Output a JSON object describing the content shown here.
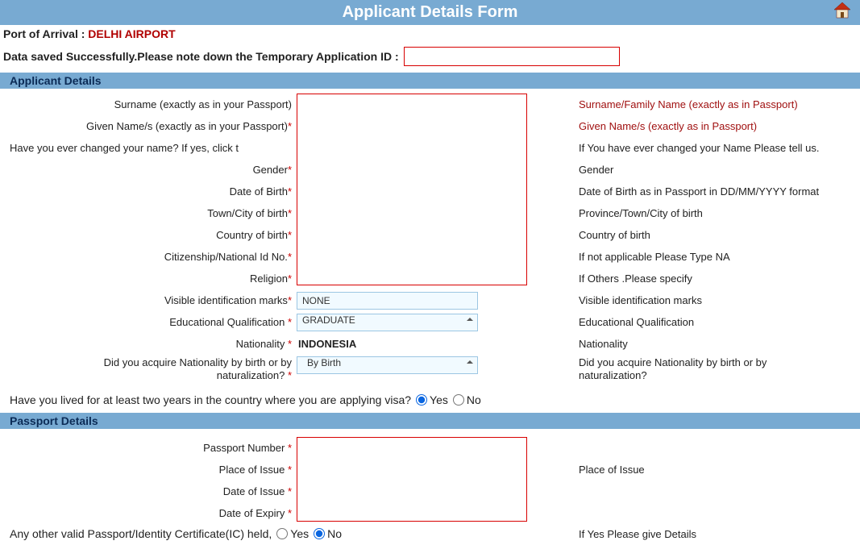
{
  "header": {
    "title": "Applicant Details Form"
  },
  "port": {
    "label": "Port of Arrival : ",
    "value": "DELHI AIRPORT"
  },
  "savedMsg": "Data saved Successfully.Please note down the Temporary Application ID :",
  "sections": {
    "applicant": "Applicant Details",
    "passport": "Passport Details"
  },
  "applicant": {
    "surname": {
      "label": "Surname (exactly as in your Passport)",
      "hint": "Surname/Family Name (exactly as in Passport)"
    },
    "given": {
      "label": "Given Name/s (exactly as in your Passport)",
      "star": "*",
      "hint": "Given Name/s (exactly as in Passport)"
    },
    "changed": {
      "label": "Have you ever changed your name? If yes, click t",
      "hint": "If You have ever changed your Name Please tell us."
    },
    "gender": {
      "label": "Gender",
      "star": "*",
      "hint": "Gender"
    },
    "dob": {
      "label": "Date of Birth",
      "star": "*",
      "hint": "Date of Birth as in Passport in DD/MM/YYYY format"
    },
    "town": {
      "label": "Town/City of birth",
      "star": "*",
      "hint": "Province/Town/City of birth"
    },
    "country": {
      "label": "Country of birth",
      "star": "*",
      "hint": "Country of birth"
    },
    "cid": {
      "label": "Citizenship/National Id No.",
      "star": "*",
      "hint": "If not applicable Please Type NA"
    },
    "religion": {
      "label": "Religion",
      "star": "*",
      "hint": "If Others .Please specify"
    },
    "marks": {
      "label": "Visible identification marks",
      "star": "*",
      "value": "NONE",
      "hint": "Visible identification marks"
    },
    "edu": {
      "label": "Educational Qualification ",
      "star": "*",
      "value": "GRADUATE",
      "hint": "Educational Qualification"
    },
    "nationality": {
      "label": "Nationality ",
      "star": "*",
      "value": "INDONESIA",
      "hint": "Nationality"
    },
    "acquire": {
      "label": "Did you acquire Nationality by birth or by naturalization? ",
      "star": "*",
      "value": "By Birth",
      "hint": "Did you acquire Nationality by birth or by naturalization?"
    },
    "twoYears": {
      "label": "Have you lived for at least two years in the country where you are applying visa? ",
      "yesLabel": "Yes",
      "noLabel": "No"
    }
  },
  "passport": {
    "number": {
      "label": "Passport Number ",
      "star": "*"
    },
    "placeIssue": {
      "label": "Place of Issue ",
      "star": "*",
      "hint": "Place of Issue"
    },
    "dateIssue": {
      "label": "Date of Issue ",
      "star": "*"
    },
    "dateExpiry": {
      "label": "Date of Expiry ",
      "star": "*"
    },
    "other": {
      "label": "Any other valid Passport/Identity Certificate(IC) held, ",
      "yesLabel": "Yes",
      "noLabel": "No",
      "hint": "If Yes Please give Details"
    }
  }
}
